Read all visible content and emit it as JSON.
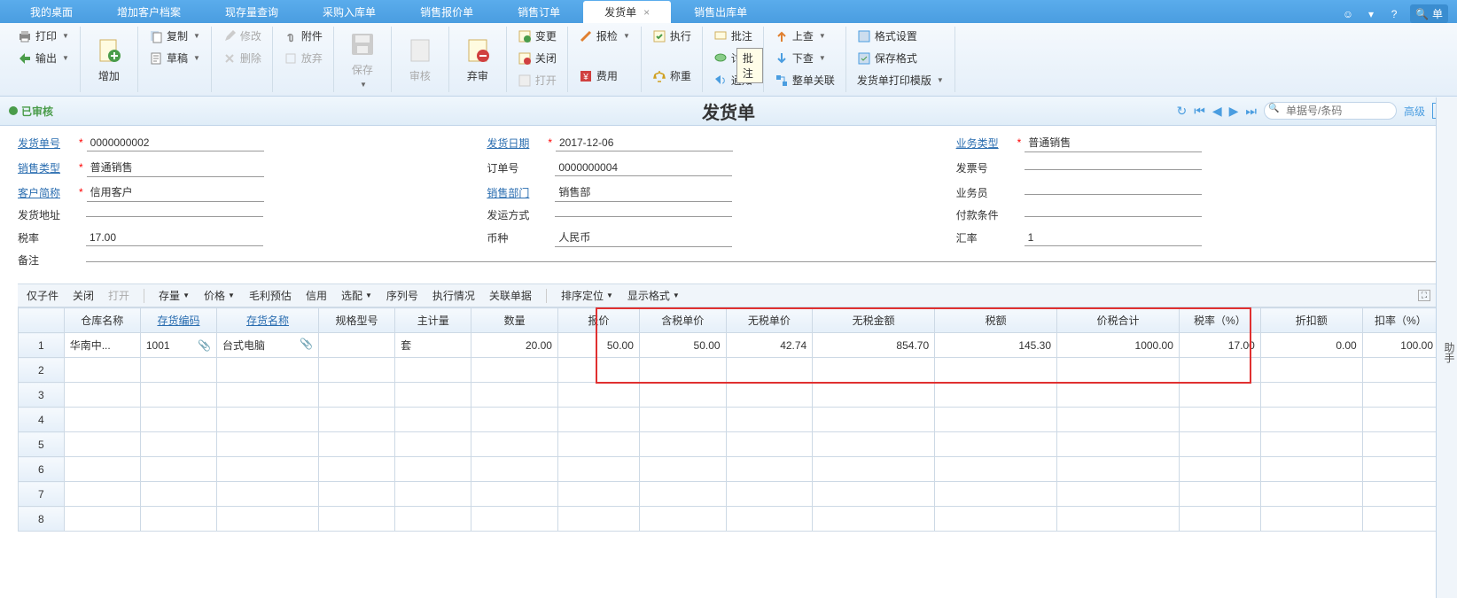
{
  "tabs": [
    "我的桌面",
    "增加客户档案",
    "现存量查询",
    "采购入库单",
    "销售报价单",
    "销售订单",
    "发货单",
    "销售出库单"
  ],
  "active_tab": "发货单",
  "search_hint": "单",
  "toolbar": {
    "print": "打印",
    "export": "输出",
    "add": "增加",
    "copy": "复制",
    "draft": "草稿",
    "modify": "修改",
    "delete": "删除",
    "attach": "附件",
    "pending": "放弃",
    "save": "保存",
    "audit": "审核",
    "unaudit": "弃审",
    "change": "变更",
    "close": "关闭",
    "open": "打开",
    "check": "报检",
    "execute": "执行",
    "cost": "费用",
    "weigh": "称重",
    "note": "批注",
    "discuss": "讨论",
    "notify": "通知",
    "up": "上查",
    "down": "下查",
    "linkbill": "整单关联",
    "format": "格式设置",
    "savefmt": "保存格式",
    "printtpl": "发货单打印模版"
  },
  "tooltip_note": "批注",
  "status": "已审核",
  "title": "发货单",
  "nav_search_ph": "单据号/条码",
  "nav_advanced": "高级",
  "form": {
    "bill_no_l": "发货单号",
    "bill_no": "0000000002",
    "date_l": "发货日期",
    "date": "2017-12-06",
    "biz_type_l": "业务类型",
    "biz_type": "普通销售",
    "sale_type_l": "销售类型",
    "sale_type": "普通销售",
    "order_no_l": "订单号",
    "order_no": "0000000004",
    "invoice_l": "发票号",
    "invoice": "",
    "cust_l": "客户简称",
    "cust": "信用客户",
    "dept_l": "销售部门",
    "dept": "销售部",
    "salesman_l": "业务员",
    "salesman": "",
    "addr_l": "发货地址",
    "addr": "",
    "ship_l": "发运方式",
    "ship": "",
    "pay_l": "付款条件",
    "pay": "",
    "taxrate_l": "税率",
    "taxrate": "17.00",
    "currency_l": "币种",
    "currency": "人民币",
    "exrate_l": "汇率",
    "exrate": "1",
    "remark_l": "备注",
    "remark": ""
  },
  "sub": {
    "child": "仅子件",
    "close": "关闭",
    "open": "打开",
    "stock": "存量",
    "price": "价格",
    "gross": "毛利预估",
    "credit": "信用",
    "opt": "选配",
    "serial": "序列号",
    "exec": "执行情况",
    "rel": "关联单据",
    "sort": "排序定位",
    "display": "显示格式"
  },
  "cols": {
    "wh": "仓库名称",
    "code": "存货编码",
    "name": "存货名称",
    "spec": "规格型号",
    "unit": "主计量",
    "qty": "数量",
    "price": "报价",
    "taxprice": "含税单价",
    "notaxprice": "无税单价",
    "notaxamt": "无税金额",
    "tax": "税额",
    "total": "价税合计",
    "taxrate": "税率（%）",
    "discount": "折扣额",
    "discrate": "扣率（%）"
  },
  "row": {
    "wh": "华南中...",
    "code": "1001",
    "name": "台式电脑",
    "spec": "",
    "unit": "套",
    "qty": "20.00",
    "price": "50.00",
    "taxprice": "50.00",
    "notaxprice": "42.74",
    "notaxamt": "854.70",
    "tax": "145.30",
    "total": "1000.00",
    "taxrate": "17.00",
    "discount": "0.00",
    "discrate": "100.00"
  },
  "side": "助手"
}
